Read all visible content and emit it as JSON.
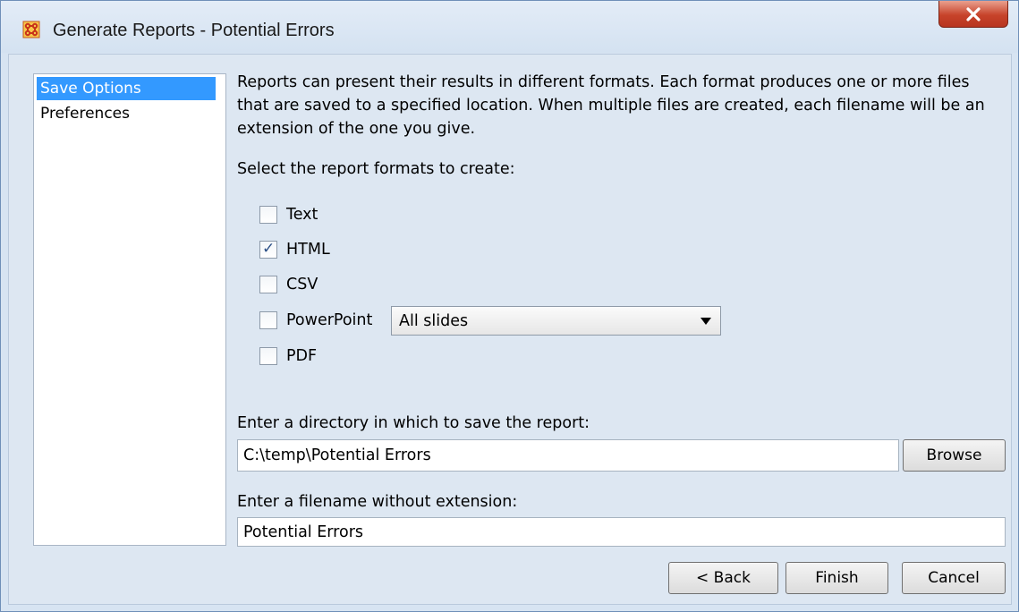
{
  "window": {
    "title": "Generate Reports - Potential Errors"
  },
  "nav": {
    "items": [
      {
        "label": "Save Options",
        "selected": true
      },
      {
        "label": "Preferences",
        "selected": false
      }
    ]
  },
  "content": {
    "description": "Reports can present their results in different formats. Each format produces one or more files that are saved to a specified location. When multiple files are created, each filename will be an extension of the one you give.",
    "formats_prompt": "Select the report formats to create:",
    "formats": [
      {
        "label": "Text",
        "checked": false
      },
      {
        "label": "HTML",
        "checked": true
      },
      {
        "label": "CSV",
        "checked": false
      },
      {
        "label": "PowerPoint",
        "checked": false
      },
      {
        "label": "PDF",
        "checked": false
      }
    ],
    "powerpoint_select": {
      "value": "All slides"
    },
    "directory_prompt": "Enter a directory in which to save the report:",
    "directory_value": "C:\\temp\\Potential Errors",
    "browse_label": "Browse",
    "filename_prompt": "Enter a filename without extension:",
    "filename_value": "Potential Errors"
  },
  "footer": {
    "back_label": "< Back",
    "finish_label": "Finish",
    "cancel_label": "Cancel"
  },
  "colors": {
    "selection": "#3399ff",
    "close_button": "#c7432a",
    "window_frame": "#d7e4f2"
  }
}
